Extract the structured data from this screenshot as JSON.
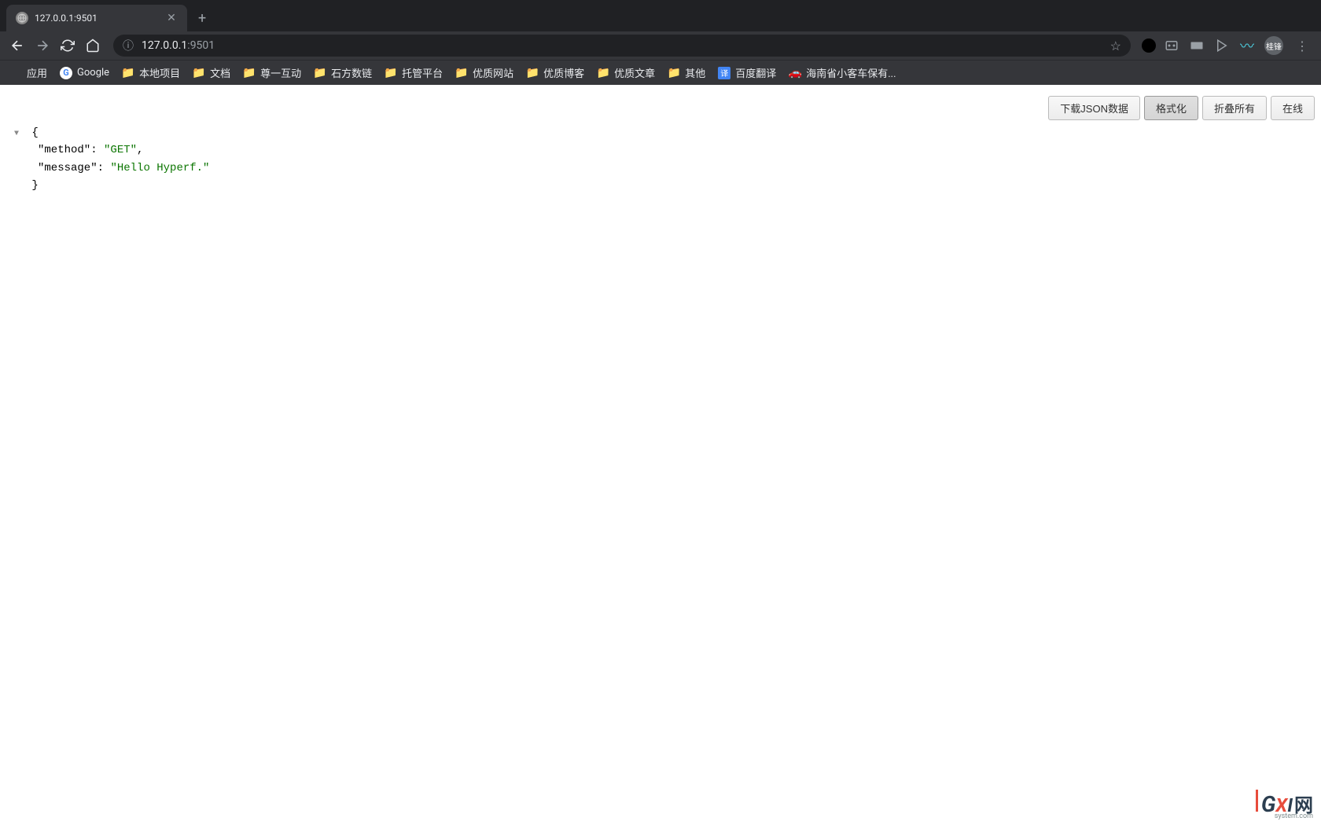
{
  "tab": {
    "title": "127.0.0.1:9501"
  },
  "address": {
    "host": "127.0.0.1",
    "port": ":9501"
  },
  "avatar": "桂锋",
  "bookmarks": {
    "apps": "应用",
    "google": "Google",
    "local": "本地项目",
    "docs": "文档",
    "zunyi": "尊一互动",
    "shifang": "石方数链",
    "hosting": "托管平台",
    "quality_site": "优质网站",
    "quality_blog": "优质博客",
    "quality_article": "优质文章",
    "other": "其他",
    "baidu_translate": "百度翻译",
    "hainan_car": "海南省小客车保有..."
  },
  "json_toolbar": {
    "download": "下载JSON数据",
    "format": "格式化",
    "collapse_all": "折叠所有",
    "online": "在线"
  },
  "json_content": {
    "key1": "\"method\"",
    "val1": "\"GET\"",
    "key2": "\"message\"",
    "val2": "\"Hello Hyperf.\"",
    "open_brace": "{",
    "close_brace": "}",
    "colon": ": ",
    "comma": ","
  },
  "watermark": {
    "g": "G",
    "x": "X",
    "i": "I",
    "net": "网",
    "sub": "system.com"
  }
}
